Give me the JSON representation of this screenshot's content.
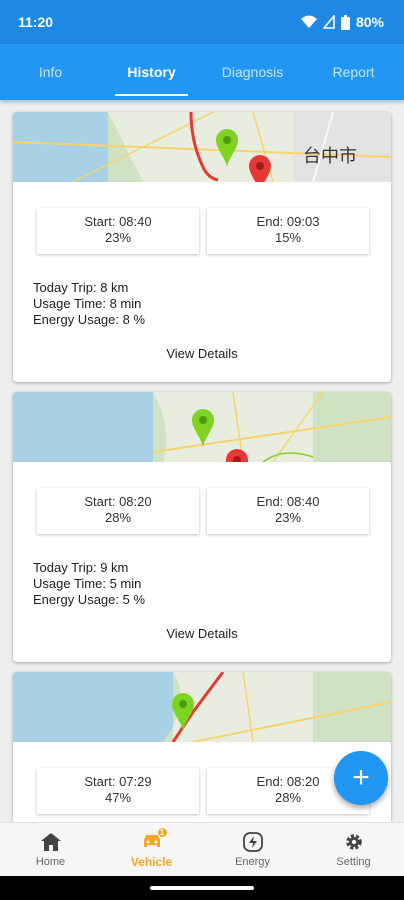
{
  "status": {
    "time": "11:20",
    "battery": "80%"
  },
  "tabs": [
    {
      "label": "Info"
    },
    {
      "label": "History"
    },
    {
      "label": "Diagnosis"
    },
    {
      "label": "Report"
    }
  ],
  "trips": [
    {
      "map_label": "台中市",
      "start": "Start: 08:40",
      "start_pct": "23%",
      "end": "End: 09:03",
      "end_pct": "15%",
      "trip": "Today Trip: 8 km",
      "usage": "Usage Time: 8 min",
      "energy": "Energy Usage: 8 %",
      "details": "View Details"
    },
    {
      "map_label": "",
      "start": "Start: 08:20",
      "start_pct": "28%",
      "end": "End: 08:40",
      "end_pct": "23%",
      "trip": "Today Trip: 9 km",
      "usage": "Usage Time: 5 min",
      "energy": "Energy Usage: 5 %",
      "details": "View Details"
    },
    {
      "map_label": "",
      "start": "Start: 07:29",
      "start_pct": "47%",
      "end": "End: 08:20",
      "end_pct": "28%",
      "trip": "",
      "usage": "",
      "energy": "",
      "details": ""
    }
  ],
  "fab": {
    "label": "+"
  },
  "nav": [
    {
      "label": "Home",
      "icon": "home-icon"
    },
    {
      "label": "Vehicle",
      "icon": "vehicle-icon",
      "badge": "1"
    },
    {
      "label": "Energy",
      "icon": "energy-icon"
    },
    {
      "label": "Setting",
      "icon": "gear-icon"
    }
  ],
  "colors": {
    "primary": "#2196f3",
    "status_bar": "#1e88e5",
    "active_nav": "#f5a623",
    "pin_start": "#7ed321",
    "pin_end": "#e53935"
  }
}
